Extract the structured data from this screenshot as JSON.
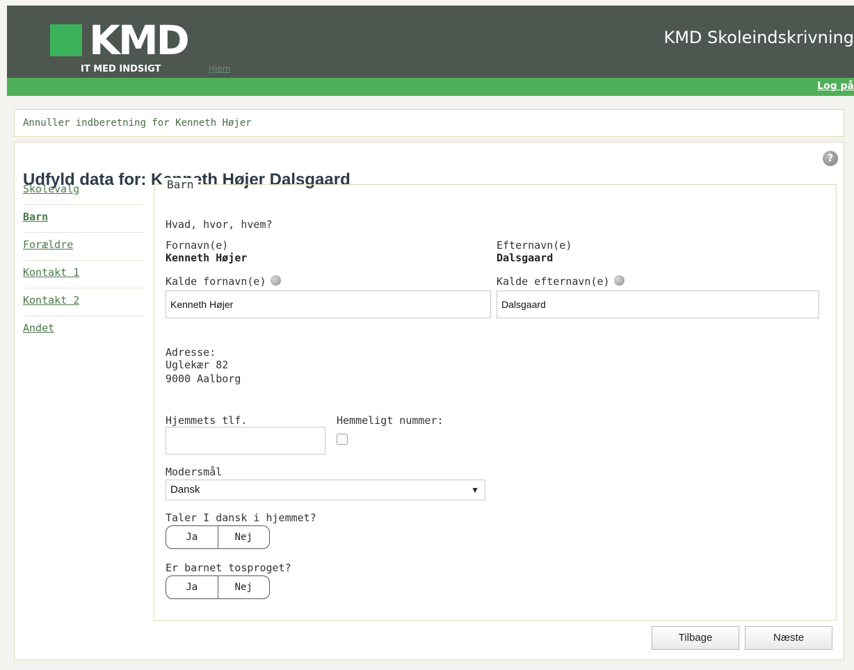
{
  "header": {
    "logo_text": "KMD",
    "logo_tagline": "IT MED INDSIGT",
    "nav_home": "Hjem",
    "app_title": "KMD Skoleindskrivning",
    "login_link": "Log på"
  },
  "cancel_link": "Annuller indberetning for Kenneth Højer",
  "page_title": "Udfyld data for: Kenneth Højer Dalsgaard",
  "side_nav": [
    {
      "label": "Skolevalg"
    },
    {
      "label": "Barn"
    },
    {
      "label": "Forældre"
    },
    {
      "label": "Kontakt 1"
    },
    {
      "label": "Kontakt 2"
    },
    {
      "label": "Andet"
    }
  ],
  "form": {
    "legend": "Barn",
    "intro": "Hvad, hvor, hvem?",
    "first_name_label": "Fornavn(e)",
    "first_name_value": "Kenneth Højer",
    "last_name_label": "Efternavn(e)",
    "last_name_value": "Dalsgaard",
    "call_first_label": "Kalde fornavn(e)",
    "call_first_value": "Kenneth Højer",
    "call_last_label": "Kalde efternavn(e)",
    "call_last_value": "Dalsgaard",
    "address_label": "Adresse:",
    "address_street": "Uglekær 82",
    "address_city": "9000  Aalborg",
    "home_phone_label": "Hjemmets tlf.",
    "home_phone_value": "",
    "secret_number_label": "Hemmeligt nummer:",
    "secret_number_checked": false,
    "mother_tongue_label": "Modersmål",
    "mother_tongue_value": "Dansk",
    "danish_at_home_label": "Taler I dansk i hjemmet?",
    "bilingual_label": "Er barnet tosproget?",
    "yes": "Ja",
    "no": "Nej"
  },
  "buttons": {
    "back": "Tilbage",
    "next": "Næste"
  },
  "colors": {
    "header_bg": "#4d5750",
    "green_bar": "#4faf58",
    "logo_green": "#3cb35a",
    "link_green": "#4c7a4c"
  }
}
